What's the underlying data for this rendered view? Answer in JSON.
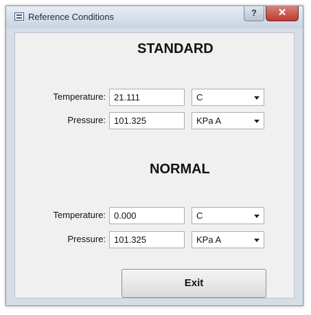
{
  "window": {
    "title": "Reference Conditions",
    "help_label": "?",
    "close_label": "✕"
  },
  "standard": {
    "heading": "STANDARD",
    "temperature": {
      "label": "Temperature:",
      "value": "21.111",
      "unit": "C"
    },
    "pressure": {
      "label": "Pressure:",
      "value": "101.325",
      "unit": "KPa A"
    }
  },
  "normal": {
    "heading": "NORMAL",
    "temperature": {
      "label": "Temperature:",
      "value": "0.000",
      "unit": "C"
    },
    "pressure": {
      "label": "Pressure:",
      "value": "101.325",
      "unit": "KPa A"
    }
  },
  "exit_label": "Exit",
  "icons": [
    "app-window-icon",
    "dropdown-arrow-icon"
  ]
}
